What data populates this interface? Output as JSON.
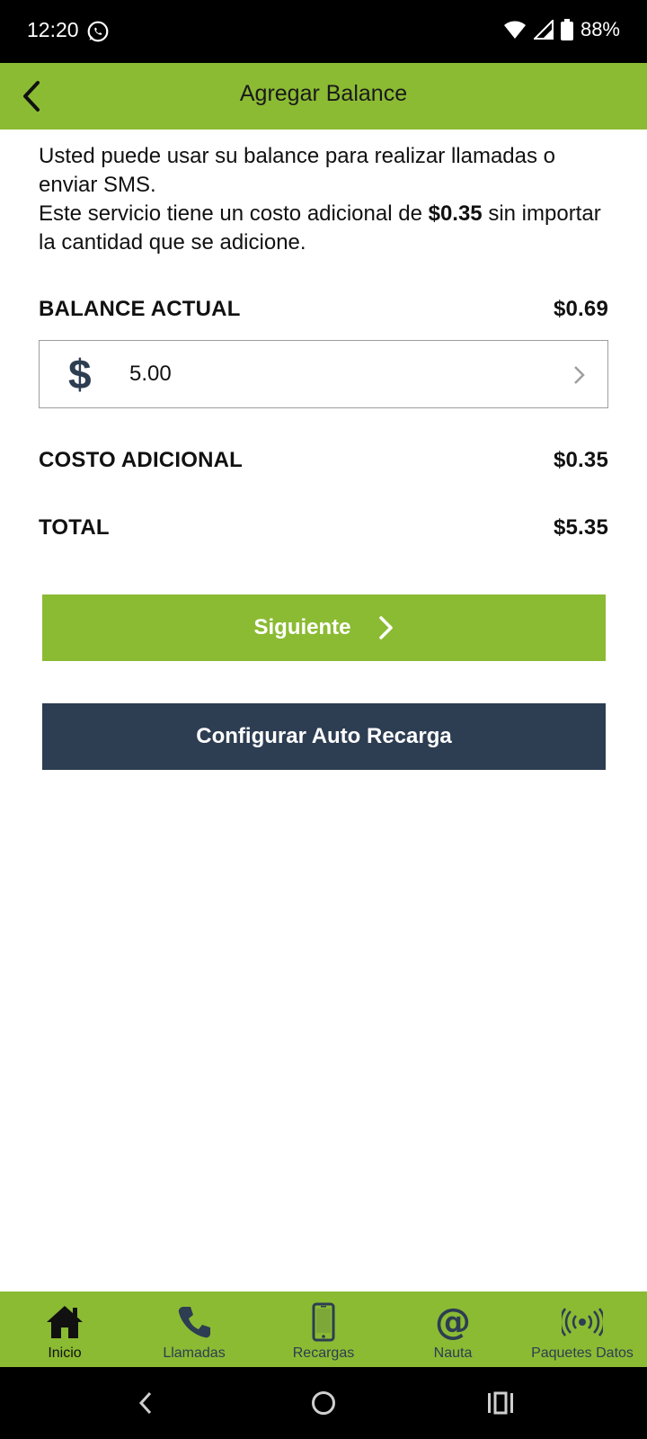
{
  "status_bar": {
    "time": "12:20",
    "battery": "88%",
    "icons": [
      "whatsapp-icon",
      "wifi-icon",
      "signal-icon",
      "battery-icon"
    ]
  },
  "header": {
    "title": "Agregar Balance",
    "back_icon": "arrow-left-icon"
  },
  "intro": {
    "line1": "Usted puede usar su balance para realizar llamadas o enviar SMS.",
    "line2_prefix": "Este servicio tiene un costo adicional de ",
    "line2_bold": "$0.35",
    "line2_suffix": " sin importar la cantidad que se adicione."
  },
  "balance": {
    "label": "BALANCE ACTUAL",
    "value": "$0.69"
  },
  "amount_input": {
    "currency_symbol": "$",
    "value": "5.00"
  },
  "fee": {
    "label": "COSTO ADICIONAL",
    "value": "$0.35"
  },
  "total": {
    "label": "TOTAL",
    "value": "$5.35"
  },
  "buttons": {
    "next_label": "Siguiente",
    "auto_recharge_label": "Configurar Auto Recarga"
  },
  "bottom_nav": {
    "items": [
      {
        "label": "Inicio",
        "icon": "home-icon",
        "active": true
      },
      {
        "label": "Llamadas",
        "icon": "phone-icon",
        "active": false
      },
      {
        "label": "Recargas",
        "icon": "smartphone-icon",
        "active": false
      },
      {
        "label": "Nauta",
        "icon": "at-sign-icon",
        "active": false
      },
      {
        "label": "Paquetes Datos",
        "icon": "broadcast-icon",
        "active": false
      }
    ]
  },
  "colors": {
    "accent_green": "#8bbb33",
    "navy": "#2d3d52"
  }
}
